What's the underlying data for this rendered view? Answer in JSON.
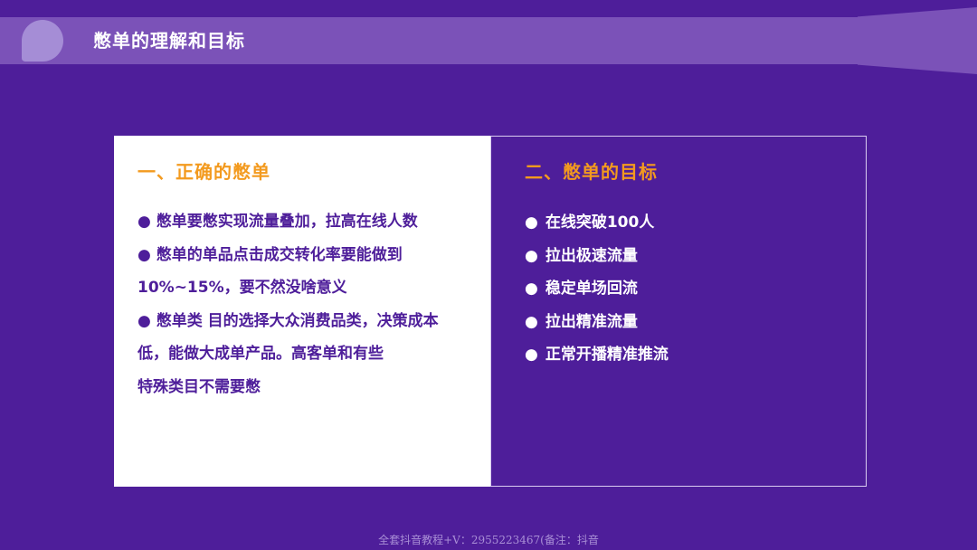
{
  "slide": {
    "title": "憋单的理解和目标"
  },
  "left_panel": {
    "heading": "一、正确的憋单",
    "paragraphs": [
      "●  憋单要憋实现流量叠加，拉高在线人数",
      "●  憋单的单品点击成交转化率要能做到10%~15%，要不然没啥意义",
      "●  憋单类 目的选择大众消费品类，决策成本低，能做大成单产品。高客单和有些",
      "特殊类目不需要憋"
    ]
  },
  "right_panel": {
    "heading": "二、憋单的目标",
    "items": [
      "在线突破100人",
      "拉出极速流量",
      "稳定单场回流",
      "拉出精准流量",
      "正常开播精准推流"
    ],
    "bullet": "●"
  },
  "footer": {
    "text": "全套抖音教程+V：2955223467(备注：抖音"
  },
  "colors": {
    "background": "#4E1E9A",
    "bar": "#7B52B8",
    "accent": "#F39A1E",
    "left_text": "#4E1E9A"
  }
}
